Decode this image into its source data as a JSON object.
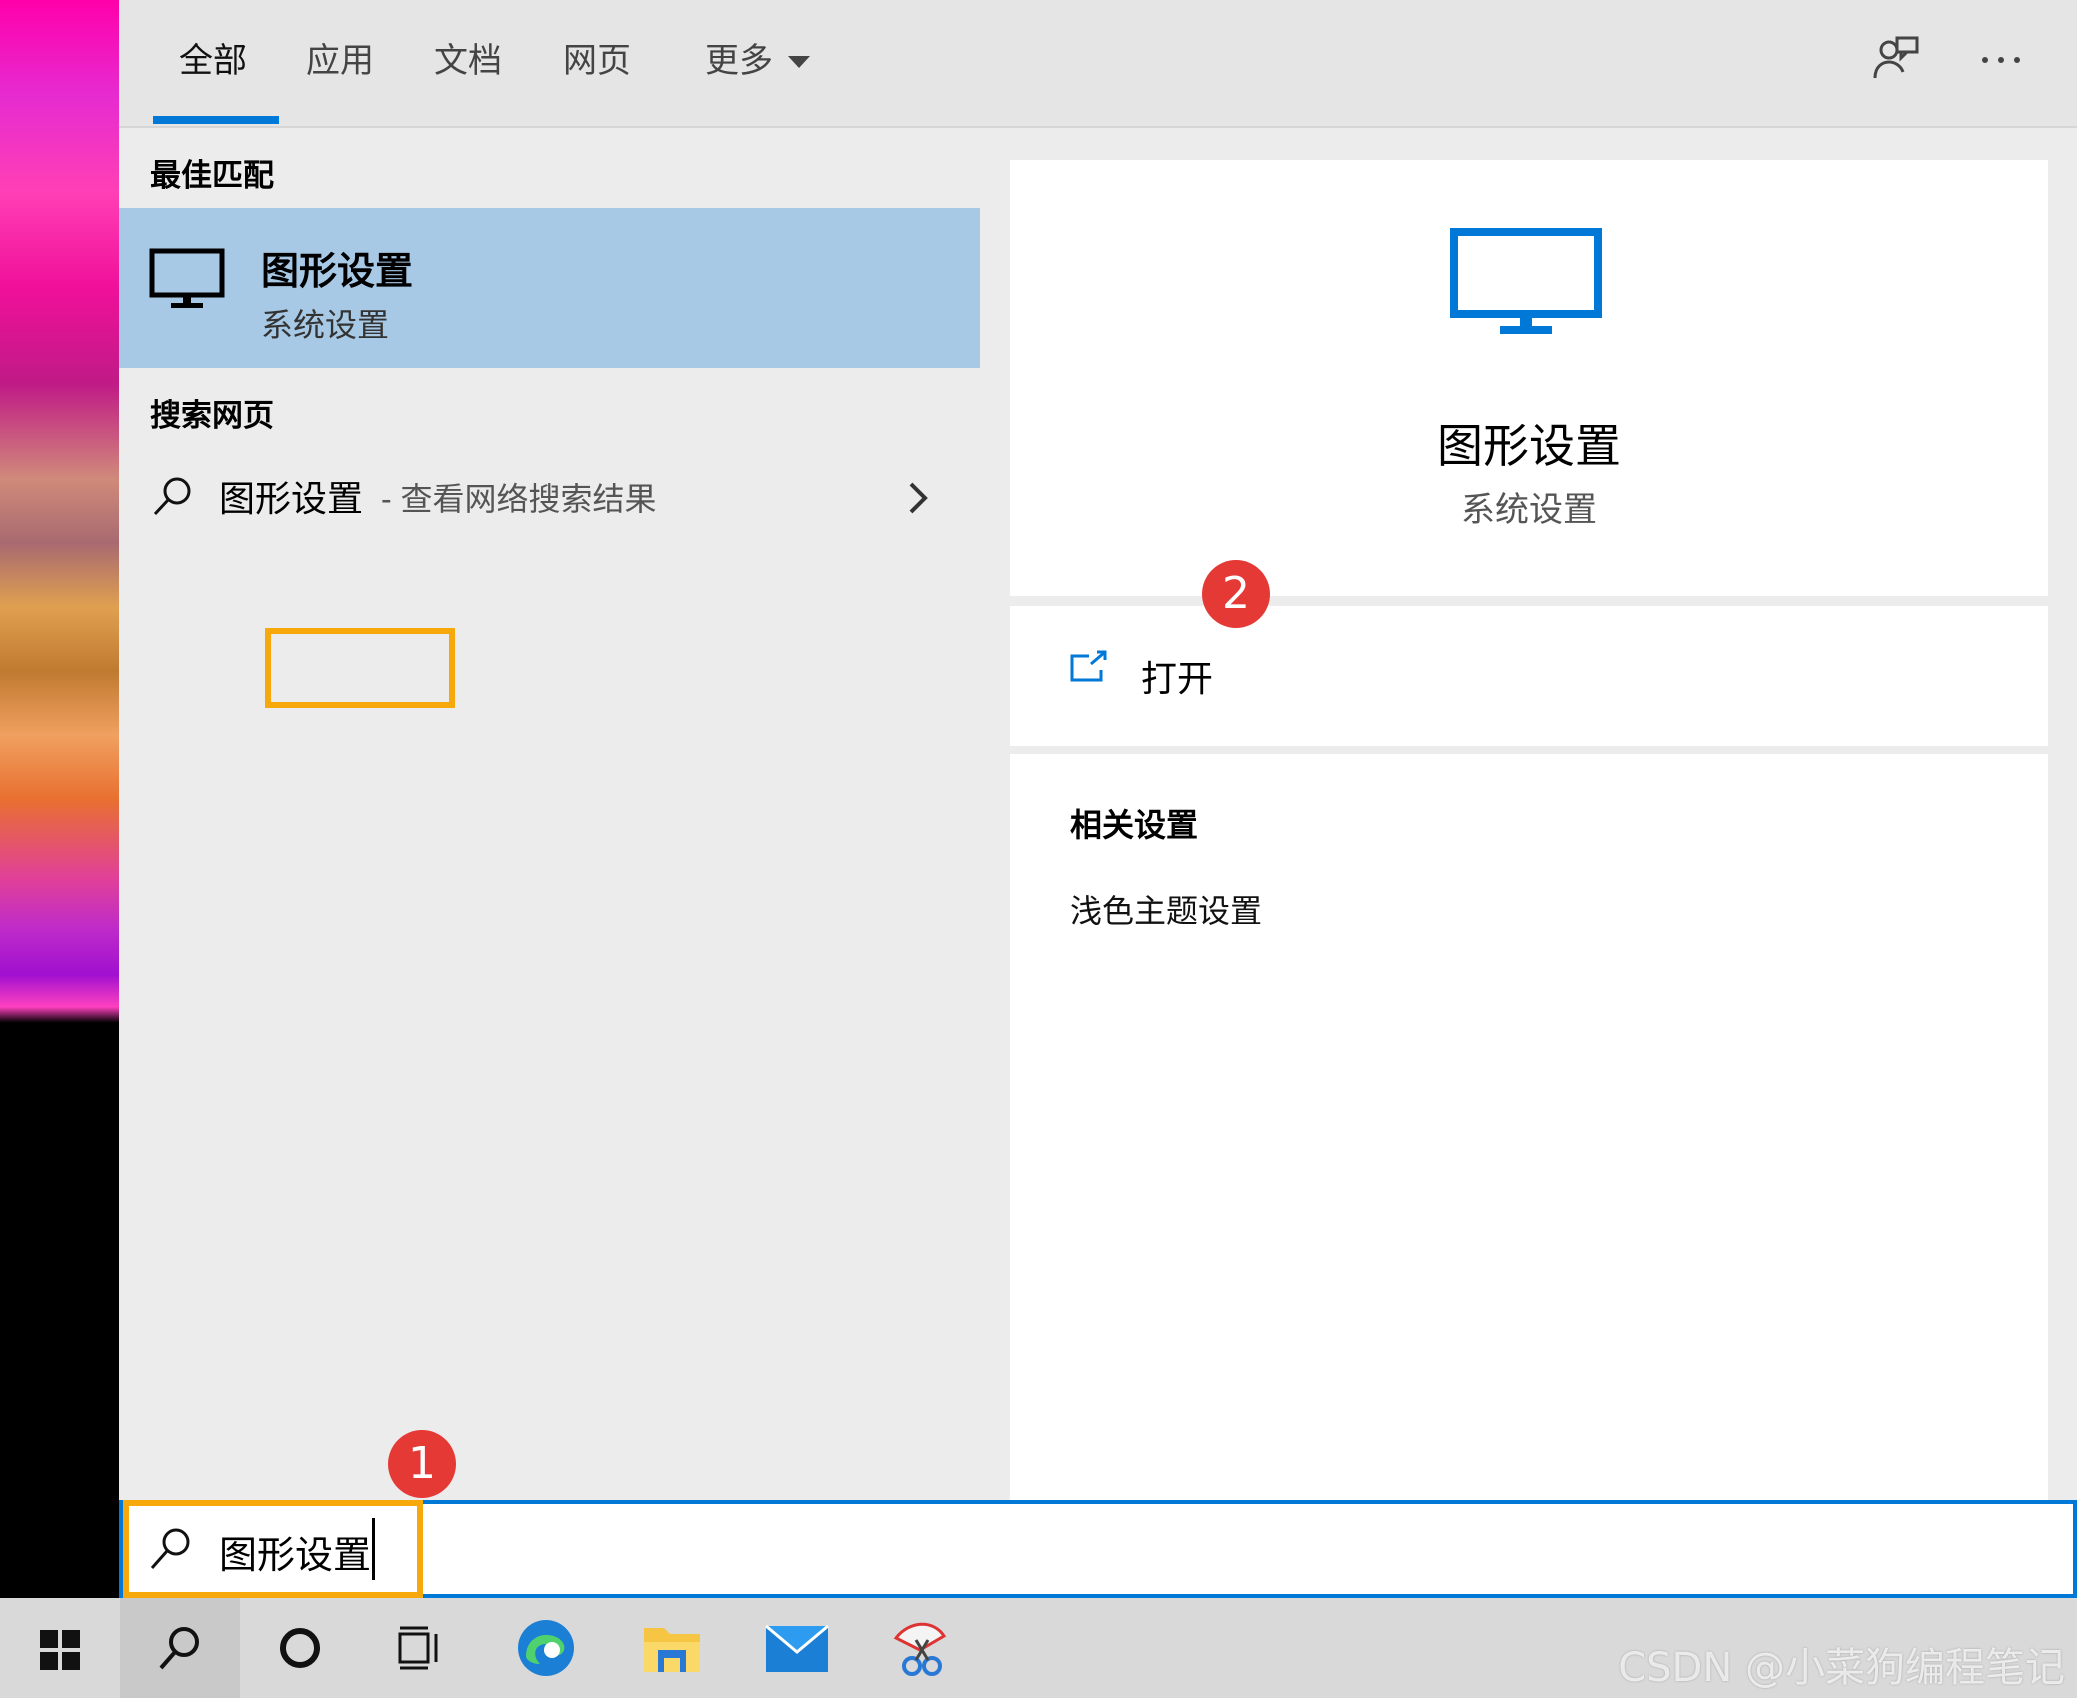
{
  "tabs": [
    {
      "label": "全部",
      "active": true
    },
    {
      "label": "应用",
      "active": false
    },
    {
      "label": "文档",
      "active": false
    },
    {
      "label": "网页",
      "active": false
    },
    {
      "label": "更多",
      "active": false
    }
  ],
  "header_icons": [
    "feedback-icon",
    "more-icon"
  ],
  "best_match": {
    "section_label": "最佳匹配",
    "title": "图形设置",
    "subtitle": "系统设置",
    "icon": "monitor-icon"
  },
  "web_search": {
    "section_label": "搜索网页",
    "query": "图形设置",
    "suffix": "- 查看网络搜索结果"
  },
  "preview": {
    "icon": "monitor-icon",
    "title": "图形设置",
    "subtitle": "系统设置",
    "open_label": "打开",
    "related_title": "相关设置",
    "related_items": [
      "浅色主题设置"
    ]
  },
  "badges": {
    "one": "1",
    "two": "2"
  },
  "search": {
    "value": "图形设置"
  },
  "taskbar_icons": [
    "windows-start-icon",
    "search-icon",
    "cortana-icon",
    "task-view-icon",
    "edge-icon",
    "file-explorer-icon",
    "mail-icon",
    "snipping-tool-icon"
  ],
  "watermark": "CSDN @小菜狗编程笔记",
  "colors": {
    "accent": "#0078d7",
    "highlight": "#f7a90b",
    "selected": "#a8c9e6",
    "badge": "#e53935"
  }
}
